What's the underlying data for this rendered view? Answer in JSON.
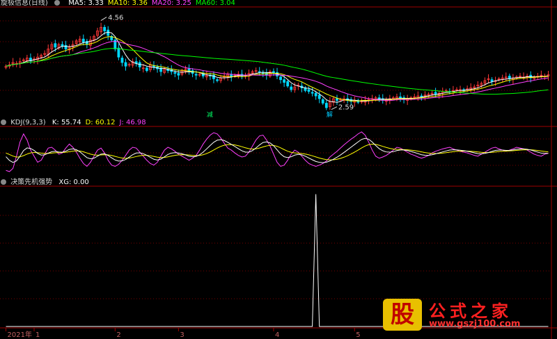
{
  "colors": {
    "bg": "#000000",
    "grid": "#7a0000",
    "border": "#a00000",
    "axis_text": "#c06060",
    "up": "#ff3838",
    "down": "#00d8ff",
    "ma5": "#ffffff",
    "ma10": "#ffff00",
    "ma20": "#ff40ff",
    "ma60": "#00ff00",
    "k": "#ffffff",
    "d": "#ffff00",
    "j": "#ff40ff",
    "xg": "#ffffff"
  },
  "panels": {
    "price": {
      "title": "旋极信息(日线)",
      "legend": [
        {
          "label": "MA5: 3.33",
          "color": "#ffffff"
        },
        {
          "label": "MA10: 3.36",
          "color": "#ffff00"
        },
        {
          "label": "MA20: 3.25",
          "color": "#ff40ff"
        },
        {
          "label": "MA60: 3.04",
          "color": "#00ff00"
        }
      ],
      "max_label": "4.56",
      "min_label": "2.59",
      "marker_jian": "减",
      "marker_jiao": "解"
    },
    "kdj": {
      "title": "KDJ(9,3,3)",
      "legend": [
        {
          "label": "K: 55.74",
          "color": "#ffffff"
        },
        {
          "label": "D: 60.12",
          "color": "#ffff00"
        },
        {
          "label": "J: 46.98",
          "color": "#ff40ff"
        }
      ]
    },
    "xg": {
      "title": "决策先机强势",
      "legend": [
        {
          "label": "XG: 0.00",
          "color": "#ffffff"
        }
      ]
    }
  },
  "xaxis": {
    "labels": [
      {
        "text": "2021年",
        "idx": 0
      },
      {
        "text": "1",
        "idx": 8
      },
      {
        "text": "2",
        "idx": 31
      },
      {
        "text": "3",
        "idx": 49
      },
      {
        "text": "4",
        "idx": 76
      },
      {
        "text": "5",
        "idx": 99
      }
    ]
  },
  "watermark": {
    "logo": "股",
    "text": "公式之家",
    "url": "www.gszj100.com"
  },
  "chart_data": [
    {
      "type": "candlestick",
      "title": "旋极信息(日线)",
      "ylim": [
        2.4,
        4.8
      ],
      "n": 155,
      "close": [
        3.52,
        3.55,
        3.6,
        3.58,
        3.62,
        3.66,
        3.7,
        3.64,
        3.68,
        3.72,
        3.76,
        3.8,
        3.9,
        4.0,
        3.94,
        4.0,
        3.96,
        3.9,
        3.95,
        4.0,
        4.08,
        4.12,
        4.05,
        4.0,
        4.1,
        4.18,
        4.3,
        4.38,
        4.3,
        4.2,
        4.1,
        3.9,
        3.72,
        3.6,
        3.52,
        3.56,
        3.62,
        3.58,
        3.5,
        3.48,
        3.42,
        3.55,
        3.5,
        3.46,
        3.4,
        3.45,
        3.42,
        3.4,
        3.36,
        3.32,
        3.42,
        3.46,
        3.4,
        3.36,
        3.32,
        3.34,
        3.3,
        3.32,
        3.3,
        3.24,
        3.2,
        3.26,
        3.3,
        3.34,
        3.28,
        3.32,
        3.34,
        3.3,
        3.32,
        3.36,
        3.4,
        3.42,
        3.38,
        3.36,
        3.32,
        3.4,
        3.36,
        3.3,
        3.22,
        3.16,
        3.08,
        3.0,
        3.06,
        3.1,
        3.04,
        2.98,
        2.96,
        2.92,
        2.86,
        2.8,
        2.7,
        2.6,
        2.74,
        2.8,
        2.76,
        2.78,
        2.8,
        2.76,
        2.74,
        2.76,
        2.72,
        2.74,
        2.76,
        2.78,
        2.8,
        2.82,
        2.78,
        2.76,
        2.78,
        2.8,
        2.82,
        2.84,
        2.8,
        2.78,
        2.8,
        2.82,
        2.84,
        2.86,
        2.84,
        2.88,
        2.9,
        2.92,
        2.9,
        2.92,
        2.96,
        2.98,
        2.95,
        2.98,
        3.0,
        3.0,
        2.98,
        3.02,
        3.04,
        3.06,
        3.1,
        3.14,
        3.2,
        3.24,
        3.18,
        3.2,
        3.24,
        3.26,
        3.28,
        3.24,
        3.26,
        3.28,
        3.3,
        3.28,
        3.3,
        3.26,
        3.28,
        3.3,
        3.32,
        3.3,
        3.33
      ],
      "high_max": {
        "idx": 27,
        "value": 4.56
      },
      "low_min": {
        "idx": 92,
        "value": 2.59
      },
      "series": [
        {
          "name": "MA5",
          "last": 3.33
        },
        {
          "name": "MA10",
          "last": 3.36
        },
        {
          "name": "MA20",
          "last": 3.25
        },
        {
          "name": "MA60",
          "last": 3.04
        }
      ]
    },
    {
      "type": "line",
      "title": "KDJ(9,3,3)",
      "ylim": [
        -10,
        110
      ],
      "j": [
        5,
        2,
        10,
        40,
        75,
        95,
        80,
        55,
        40,
        25,
        30,
        45,
        60,
        62,
        55,
        45,
        48,
        60,
        70,
        62,
        50,
        35,
        22,
        15,
        25,
        40,
        55,
        60,
        48,
        30,
        18,
        15,
        20,
        30,
        42,
        55,
        62,
        60,
        50,
        40,
        30,
        22,
        18,
        25,
        40,
        55,
        62,
        58,
        52,
        45,
        40,
        35,
        30,
        35,
        42,
        55,
        70,
        82,
        92,
        98,
        95,
        85,
        72,
        60,
        55,
        48,
        42,
        38,
        40,
        50,
        65,
        80,
        90,
        92,
        80,
        65,
        45,
        25,
        15,
        18,
        30,
        45,
        55,
        50,
        40,
        30,
        22,
        18,
        15,
        18,
        22,
        28,
        38,
        45,
        52,
        60,
        68,
        75,
        82,
        88,
        95,
        100,
        92,
        75,
        55,
        40,
        35,
        38,
        42,
        48,
        55,
        62,
        60,
        55,
        50,
        45,
        42,
        38,
        35,
        38,
        42,
        48,
        52,
        55,
        58,
        60,
        62,
        58,
        55,
        52,
        50,
        48,
        45,
        42,
        40,
        45,
        50,
        55,
        60,
        62,
        58,
        55,
        52,
        55,
        58,
        62,
        60,
        58,
        55,
        50,
        45,
        42,
        40,
        45,
        47
      ],
      "final_k": 55.74,
      "final_d": 60.12,
      "final_j": 46.98
    },
    {
      "type": "line",
      "title": "决策先机强势",
      "ylim": [
        0,
        1.05
      ],
      "series": [
        {
          "name": "XG",
          "spike_idx": 88,
          "value_at_spike": 1,
          "final": 0.0
        }
      ]
    }
  ]
}
